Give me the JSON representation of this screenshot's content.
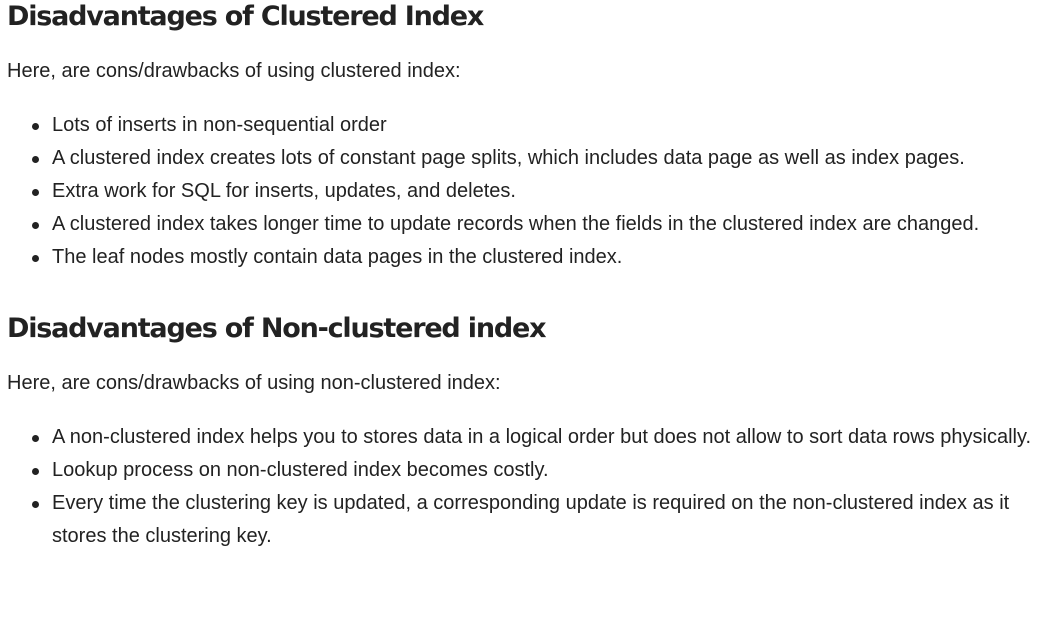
{
  "sections": [
    {
      "title": "Disadvantages of Clustered Index",
      "intro": "Here, are cons/drawbacks of using clustered index:",
      "items": [
        "Lots of inserts in non-sequential order",
        "A clustered index creates lots of constant page splits, which includes data page as well as index pages.",
        "Extra work for SQL for inserts, updates, and deletes.",
        "A clustered index takes longer time to update records when the fields in the clustered index are changed.",
        "The leaf nodes mostly contain data pages in the clustered index."
      ]
    },
    {
      "title": "Disadvantages of Non-clustered index",
      "intro": "Here, are cons/drawbacks of using non-clustered index:",
      "items": [
        "A non-clustered index helps you to stores data in a logical order but does not allow to sort data rows physically.",
        "Lookup process on non-clustered index becomes costly.",
        "Every time the clustering key is updated, a corresponding update is required on the non-clustered index as it stores the clustering key."
      ]
    }
  ]
}
